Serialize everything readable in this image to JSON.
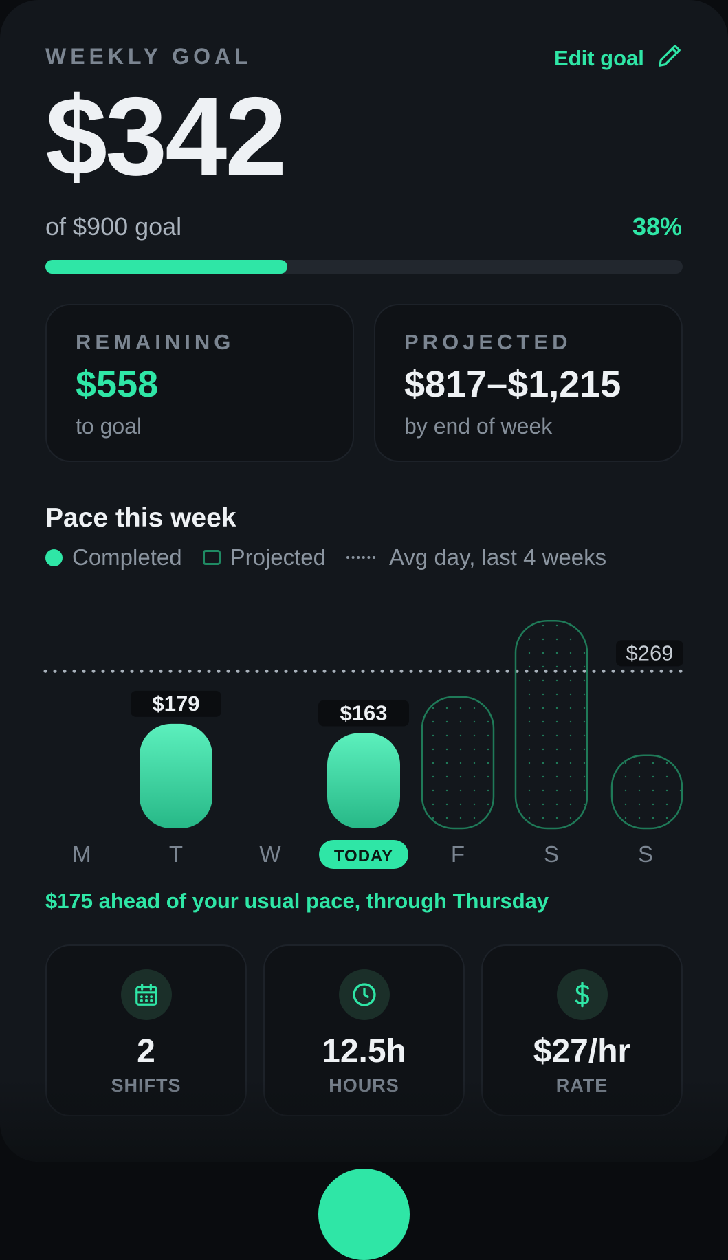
{
  "header": {
    "overline": "WEEKLY GOAL",
    "edit_label": "Edit goal",
    "earned": "$342",
    "goal_text": "of $900 goal",
    "percent_label": "38%",
    "progress_fraction": 0.38
  },
  "stats": {
    "remaining": {
      "label": "REMAINING",
      "value": "$558",
      "sub": "to goal"
    },
    "projected": {
      "label": "PROJECTED",
      "value": "$817–$1,215",
      "sub": "by end of week"
    }
  },
  "pace": {
    "title": "Pace this week",
    "legend": {
      "completed": "Completed",
      "projected": "Projected",
      "average": "Avg day, last 4 weeks"
    },
    "message": "$175 ahead of your usual pace, through Thursday"
  },
  "chart_data": {
    "type": "bar",
    "categories": [
      "M",
      "T",
      "W",
      "TODAY",
      "F",
      "S",
      "S"
    ],
    "series": [
      {
        "name": "Completed",
        "values": [
          0,
          179,
          0,
          163,
          null,
          null,
          null
        ]
      },
      {
        "name": "Projected",
        "values": [
          null,
          null,
          null,
          null,
          225,
          355,
          125
        ]
      }
    ],
    "value_labels": [
      "",
      "$179",
      "",
      "$163",
      "",
      "",
      ""
    ],
    "average_line": {
      "name": "Avg day, last 4 weeks",
      "value": 269,
      "label": "$269"
    },
    "today_index": 3,
    "ylim": [
      0,
      380
    ],
    "colors": {
      "completed_top": "#5cf0bd",
      "completed_bottom": "#27b887",
      "projected_stroke": "#1f7a58",
      "accent": "#2fe6a6"
    }
  },
  "summary": [
    {
      "icon": "calendar-icon",
      "value": "2",
      "label": "SHIFTS"
    },
    {
      "icon": "clock-icon",
      "value": "12.5h",
      "label": "HOURS"
    },
    {
      "icon": "dollar-icon",
      "value": "$27/hr",
      "label": "RATE"
    }
  ],
  "colors": {
    "accent": "#2fe6a6",
    "background": "#13171c",
    "card": "#0f1216"
  }
}
